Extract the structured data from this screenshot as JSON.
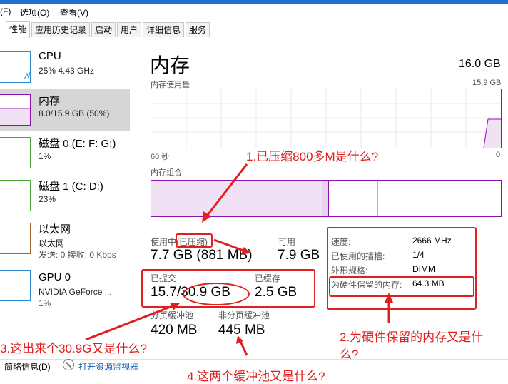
{
  "menu": {
    "file": "(F)",
    "options": "选项(O)",
    "view": "查看(V)"
  },
  "tabs": [
    "性能",
    "应用历史记录",
    "启动",
    "用户",
    "详细信息",
    "服务"
  ],
  "sidebar": [
    {
      "name": "CPU",
      "value": "25% 4.43 GHz",
      "value2": ""
    },
    {
      "name": "内存",
      "value": "8.0/15.9 GB (50%)",
      "value2": ""
    },
    {
      "name": "磁盘 0 (E: F: G:)",
      "value": "1%",
      "value2": ""
    },
    {
      "name": "磁盘 1 (C: D:)",
      "value": "23%",
      "value2": ""
    },
    {
      "name": "以太网",
      "value": "以太网",
      "value2": "发送: 0 接收: 0 Kbps"
    },
    {
      "name": "GPU 0",
      "value": "NVIDIA GeForce ...",
      "value2": "1%"
    }
  ],
  "main": {
    "title": "内存",
    "total": "16.0 GB",
    "usage_label": "内存使用量",
    "usage_max": "15.9 GB",
    "time_left": "60 秒",
    "time_right": "0",
    "composition_label": "内存组合",
    "in_use_label": "使用中",
    "compressed_label": "(已压缩)",
    "in_use_value": "7.7 GB (881 MB)",
    "available_label": "可用",
    "available_value": "7.9 GB",
    "committed_label": "已提交",
    "committed_value": "15.7/30.9 GB",
    "cached_label": "已缓存",
    "cached_value": "2.5 GB",
    "paged_pool_label": "分页缓冲池",
    "paged_pool_value": "420 MB",
    "nonpaged_pool_label": "非分页缓冲池",
    "nonpaged_pool_value": "445 MB",
    "info": [
      {
        "k": "速度:",
        "v": "2666 MHz"
      },
      {
        "k": "已使用的插槽:",
        "v": "1/4"
      },
      {
        "k": "外形规格:",
        "v": "DIMM"
      },
      {
        "k": "为硬件保留的内存:",
        "v": "64.3 MB"
      }
    ]
  },
  "footer": {
    "brief": "简略信息(D)",
    "monitor": "打开资源监视器"
  },
  "annotations": {
    "q1": "1.已压缩800多M是什么?",
    "q2a": "2.为硬件保留的内存又是什",
    "q2b": "么?",
    "q3": "3.这出来个30.9G又是什么?",
    "q4": "4.这两个缓冲池又是什么?"
  },
  "colors": {
    "accent": "#8b12ae",
    "annotation": "#e02020",
    "selected": "#d6d6d6"
  }
}
